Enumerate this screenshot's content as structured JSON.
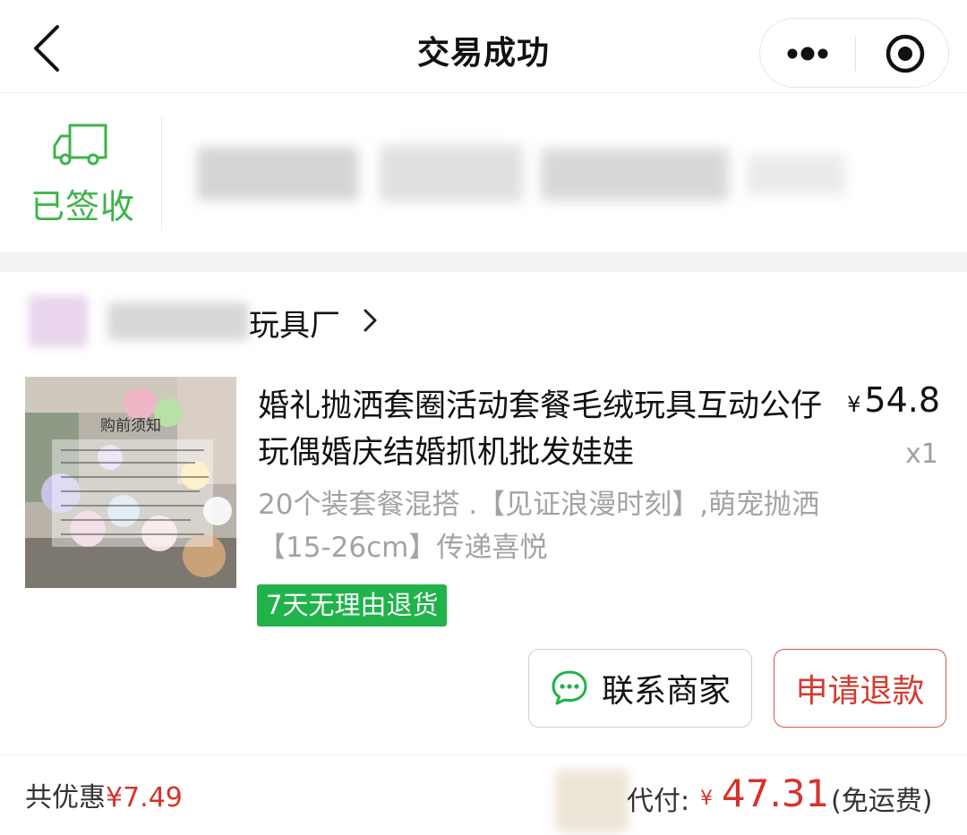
{
  "navbar": {
    "title": "交易成功",
    "back_icon": "chevron-left-icon",
    "more_icon": "more-dots-icon",
    "close_icon": "target-close-icon"
  },
  "logistics": {
    "status": "已签收",
    "icon": "truck-icon",
    "status_color": "#3cb44a"
  },
  "shop": {
    "name": "玩具厂",
    "chevron": "chevron-right-icon"
  },
  "product": {
    "image_caption": "购前须知",
    "title": "婚礼抛洒套圈活动套餐毛绒玩具互动公仔玩偶婚庆结婚抓机批发娃娃",
    "price_symbol": "¥",
    "price": "54.8",
    "quantity": "x1",
    "description": "20个装套餐混搭 .【见证浪漫时刻】,萌宠抛洒【15-26cm】传递喜悦",
    "return_policy": "7天无理由退货",
    "return_tag_color": "#1fb34a"
  },
  "actions": {
    "contact_label": "联系商家",
    "contact_icon": "chat-bubble-icon",
    "refund_label": "申请退款"
  },
  "footer": {
    "discount_label": "共优惠",
    "discount_amount": "¥7.49",
    "paid_label": "代付:",
    "paid_symbol": "¥",
    "paid_amount": "47.31",
    "shipping_note": "(免运费)",
    "accent_color": "#d8322a"
  }
}
